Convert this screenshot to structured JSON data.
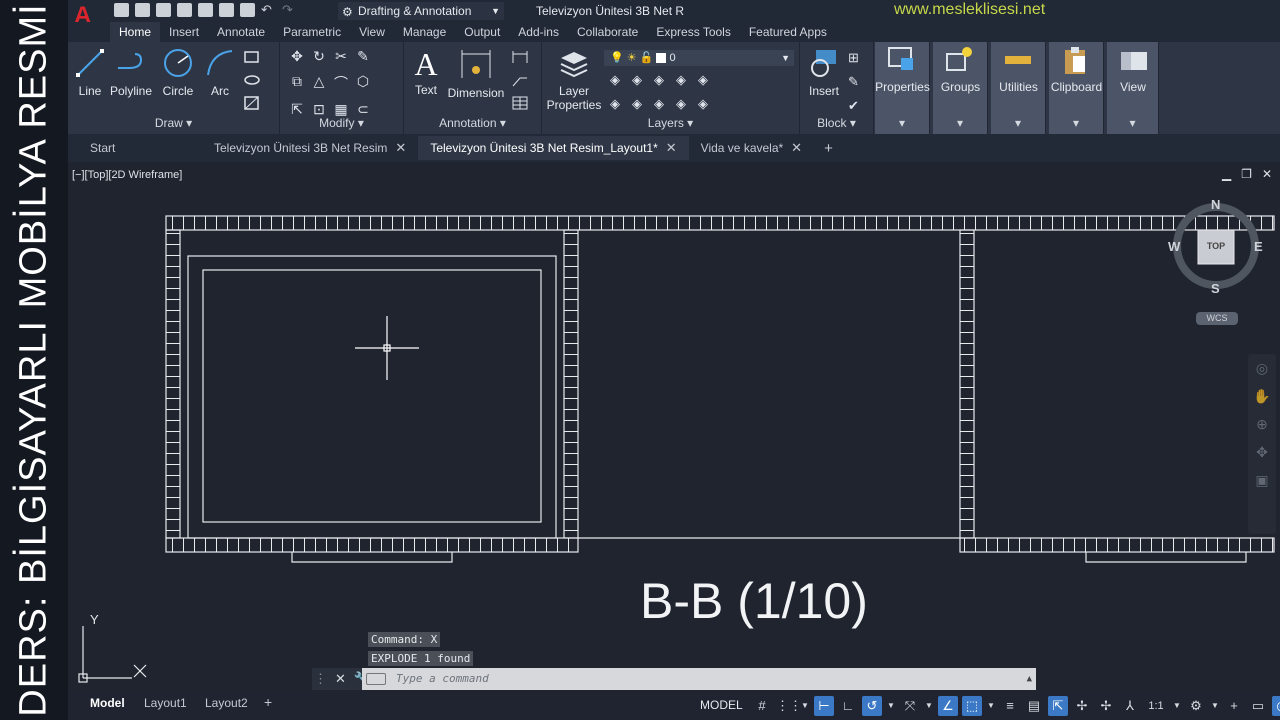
{
  "banner": {
    "text": "DERS: BİLGİSAYARLI MOBİLYA RESMİ"
  },
  "titlebar": {
    "app_logo": "A",
    "workspace": "Drafting & Annotation",
    "document_title": "Televizyon Ünitesi 3B Net R",
    "watermark_url": "www.mesleklisesi.net"
  },
  "ribbon_tabs": [
    "Home",
    "Insert",
    "Annotate",
    "Parametric",
    "View",
    "Manage",
    "Output",
    "Add-ins",
    "Collaborate",
    "Express Tools",
    "Featured Apps"
  ],
  "ribbon": {
    "draw": {
      "title": "Draw",
      "tools": [
        "Line",
        "Polyline",
        "Circle",
        "Arc"
      ]
    },
    "modify": {
      "title": "Modify"
    },
    "annotation": {
      "title": "Annotation",
      "tools": [
        "Text",
        "Dimension"
      ]
    },
    "layers": {
      "title": "Layers",
      "layer_properties": "Layer Properties",
      "current_layer": "0"
    },
    "block": {
      "title": "Block",
      "insert": "Insert"
    },
    "properties": "Properties",
    "groups": "Groups",
    "utilities": "Utilities",
    "clipboard": "Clipboard",
    "view": "View"
  },
  "file_tabs": [
    {
      "label": "Start",
      "closable": false
    },
    {
      "label": "Televizyon Ünitesi 3B Net Resim",
      "closable": true
    },
    {
      "label": "Televizyon Ünitesi 3B Net Resim_Layout1*",
      "closable": true,
      "active": true
    },
    {
      "label": "Vida ve kavela*",
      "closable": true
    }
  ],
  "viewport": {
    "label": "[−][Top][2D Wireframe]",
    "section_title": "B-B (1/10)",
    "viewcube": {
      "n": "N",
      "s": "S",
      "e": "E",
      "w": "W",
      "face": "TOP",
      "wcs": "WCS"
    },
    "ucs_y": "Y"
  },
  "command": {
    "history": [
      "Command: X",
      "EXPLODE 1 found"
    ],
    "placeholder": "Type a command"
  },
  "status": {
    "layout_tabs": [
      "Model",
      "Layout1",
      "Layout2"
    ],
    "mode": "MODEL",
    "scale": "1:1"
  },
  "colors": {
    "ribbon_bg": "#2e3646",
    "canvas_bg": "#1f242f",
    "accent": "#3b79c6",
    "logo_red": "#d9252b",
    "url_green": "#c6d84a"
  }
}
